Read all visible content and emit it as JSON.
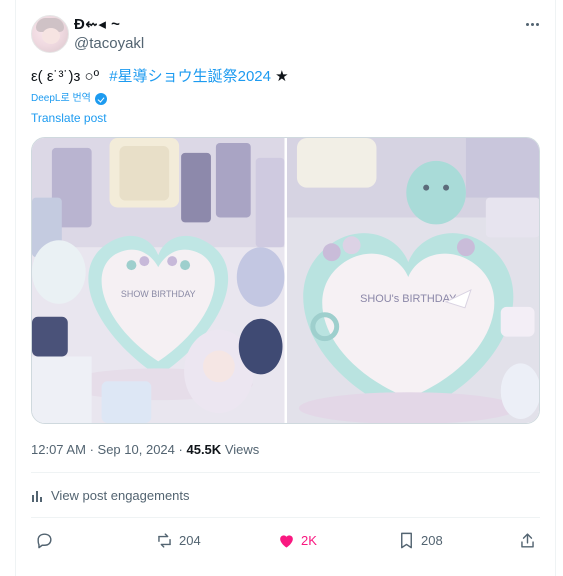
{
  "author": {
    "display_name": "Ð⇜◂ ~",
    "handle": "@tacoyakl"
  },
  "menu": {
    "icon": "more-horizontal-icon"
  },
  "post": {
    "text_prefix": "ε( ε˙³˙)з ○º",
    "hashtag": "#星導ショウ生誕祭2024",
    "text_suffix": "★",
    "deepl_label": "DeepL로 번역",
    "translate_label": "Translate post"
  },
  "media": {
    "photos": [
      {
        "name": "cake-with-acrylic-stands-photo"
      },
      {
        "name": "heart-cake-closeup-photo"
      }
    ],
    "cake_text_1": "SHOW BIRTHDAY",
    "cake_text_2": "SHOU's BIRTHDAY"
  },
  "meta": {
    "time": "12:07 AM",
    "date": "Sep 10, 2024",
    "views_count": "45.5K",
    "views_label": "Views"
  },
  "engagements_label": "View post engagements",
  "actions": {
    "reply": {
      "icon": "reply-icon",
      "count": ""
    },
    "repost": {
      "icon": "repost-icon",
      "count": "204"
    },
    "like": {
      "icon": "heart-icon",
      "count": "2K",
      "color": "#f91880"
    },
    "bookmark": {
      "icon": "bookmark-icon",
      "count": "208"
    },
    "share": {
      "icon": "share-icon",
      "count": ""
    }
  },
  "colors": {
    "accent": "#1d9bf0",
    "muted": "#536471",
    "like": "#f91880"
  }
}
